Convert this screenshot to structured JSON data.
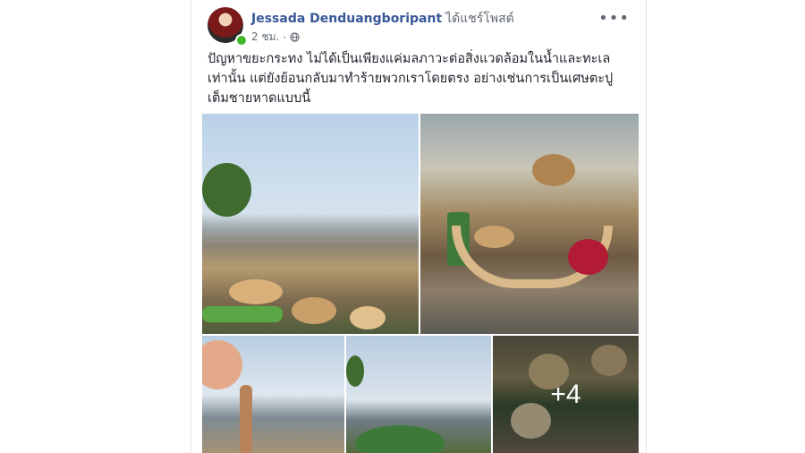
{
  "post": {
    "author": "Jessada Denduangboripant",
    "action": "ได้แชร์โพสต์",
    "time": "2 ชม.",
    "separator": "·",
    "privacy_icon": "globe-icon",
    "more_icon": "•••",
    "text_lines": [
      "ปัญหาขยะกระทง ไม่ได้เป็นเพียงแค่มลภาวะต่อสิ่งแวดล้อมในน้ำและทะเล",
      "เท่านั้น แต่ยังย้อนกลับมาทำร้ายพวกเราโดยตรง อย่างเช่นการเป็นเศษตะปู",
      "เต็มชายหาดแบบนี้"
    ],
    "more_photos_label": "+4"
  },
  "colors": {
    "author_link": "#385898",
    "online": "#42b72a",
    "text": "#1d2129",
    "meta": "#606770"
  }
}
